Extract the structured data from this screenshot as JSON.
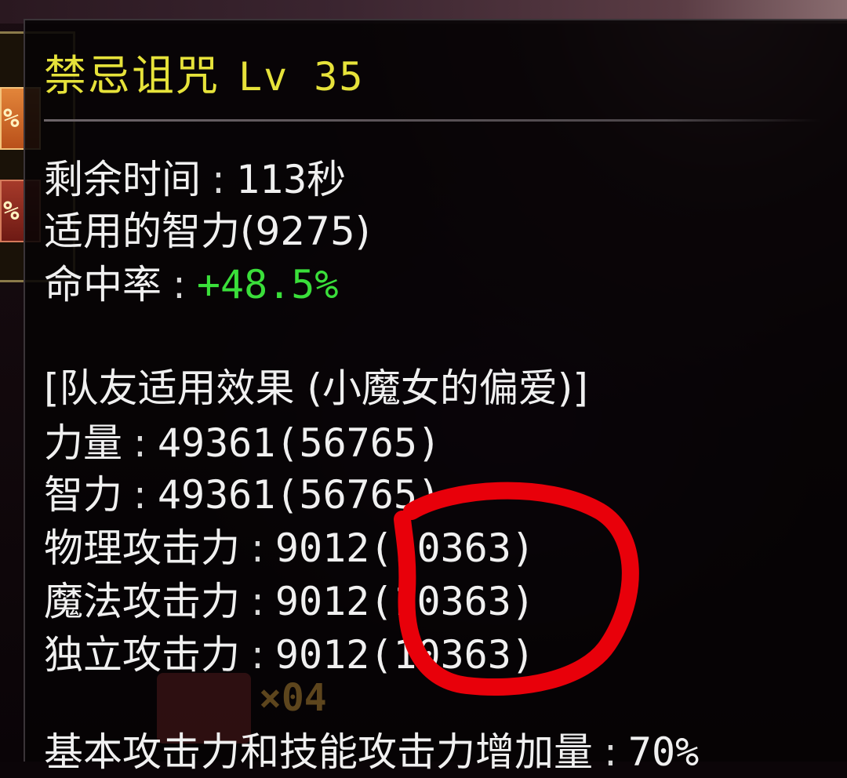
{
  "tooltip": {
    "title": "禁忌诅咒",
    "level": "Lv 35",
    "remaining_time_label": "剩余时间",
    "remaining_time_value": "113秒",
    "applied_int_text": "适用的智力(9275)",
    "hit_rate_label": "命中率",
    "hit_rate_value": "+48.5%",
    "party_effect_header": "[队友适用效果 (小魔女的偏爱)]",
    "stats": [
      {
        "label": "力量",
        "value": "49361(56765)"
      },
      {
        "label": "智力",
        "value": "49361(56765)"
      },
      {
        "label": "物理攻击力",
        "value": "9012(10363)"
      },
      {
        "label": "魔法攻击力",
        "value": "9012(10363)"
      },
      {
        "label": "独立攻击力",
        "value": "9012(10363)"
      }
    ],
    "base_attack_text": "基本攻击力和技能攻击力增加量",
    "base_attack_value": "70%"
  },
  "hud": {
    "buff_slot_1": "%",
    "buff_slot_2": "%",
    "item_count": "×04"
  },
  "colors": {
    "title": "#e6e23a",
    "positive": "#3adf3a",
    "annotation": "#e8000a"
  },
  "icons": [
    "buff-icon-orange",
    "buff-icon-red",
    "consumable-item-icon"
  ]
}
